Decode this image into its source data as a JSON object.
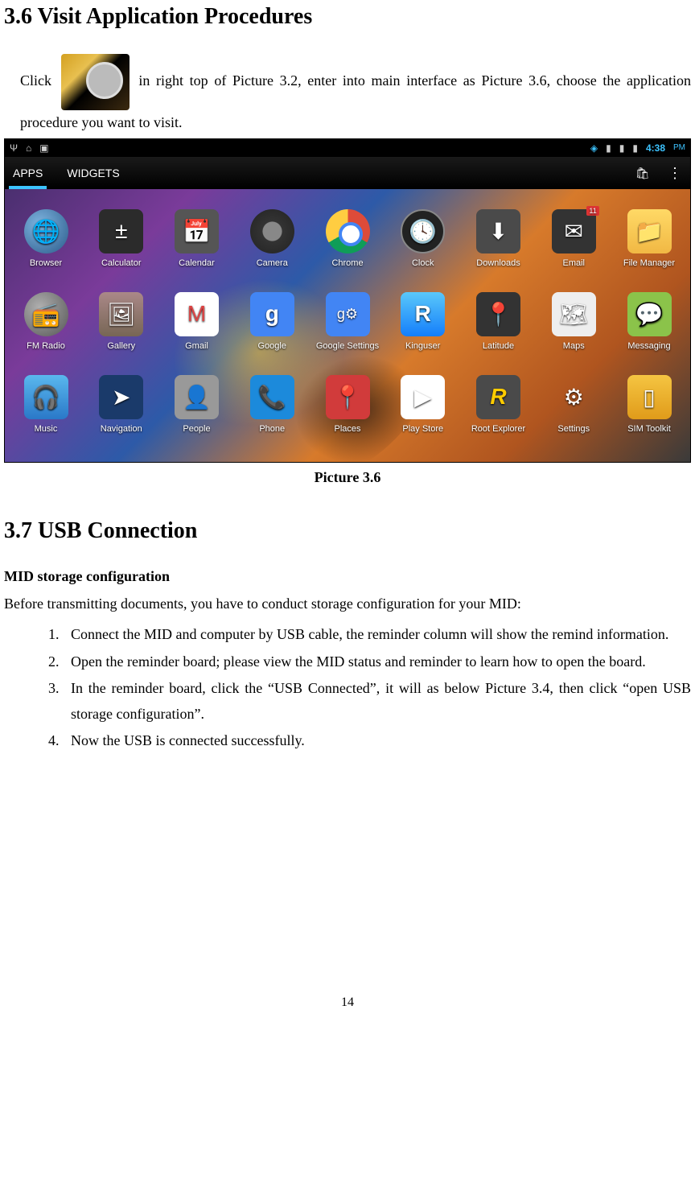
{
  "section36": {
    "title": "3.6 Visit Application Procedures",
    "para_before": "Click",
    "para_after": "in right top of Picture 3.2, enter into main interface as Picture 3.6, choose the application procedure you want to visit."
  },
  "screenshot": {
    "statusbar": {
      "left_icons": [
        "psi",
        "home",
        "android"
      ],
      "right_icons": [
        "wifi",
        "signal1",
        "signal2",
        "battery"
      ],
      "time": "4:38",
      "ampm": "PM"
    },
    "tabs": {
      "apps": "APPS",
      "widgets": "WIDGETS"
    },
    "apps": [
      [
        {
          "name": "Browser",
          "icon": "browser",
          "glyph": "🌐"
        },
        {
          "name": "Calculator",
          "icon": "calc",
          "glyph": "±"
        },
        {
          "name": "Calendar",
          "icon": "calendar",
          "glyph": "📅"
        },
        {
          "name": "Camera",
          "icon": "camera",
          "glyph": ""
        },
        {
          "name": "Chrome",
          "icon": "chrome",
          "glyph": ""
        },
        {
          "name": "Clock",
          "icon": "clock",
          "glyph": "🕓"
        },
        {
          "name": "Downloads",
          "icon": "downloads",
          "glyph": "⬇"
        },
        {
          "name": "Email",
          "icon": "email",
          "glyph": "✉",
          "badge": "11"
        },
        {
          "name": "File Manager",
          "icon": "filemgr",
          "glyph": "📁"
        }
      ],
      [
        {
          "name": "FM Radio",
          "icon": "fmradio",
          "glyph": "📻"
        },
        {
          "name": "Gallery",
          "icon": "gallery",
          "glyph": "🖼"
        },
        {
          "name": "Gmail",
          "icon": "gmail",
          "glyph": "M"
        },
        {
          "name": "Google",
          "icon": "google",
          "glyph": "g"
        },
        {
          "name": "Google Settings",
          "icon": "gsettings",
          "glyph": "g⚙"
        },
        {
          "name": "Kinguser",
          "icon": "kinguser",
          "glyph": "R"
        },
        {
          "name": "Latitude",
          "icon": "latitude",
          "glyph": "📍"
        },
        {
          "name": "Maps",
          "icon": "maps",
          "glyph": "🗺"
        },
        {
          "name": "Messaging",
          "icon": "messaging",
          "glyph": "💬"
        }
      ],
      [
        {
          "name": "Music",
          "icon": "music",
          "glyph": "🎧"
        },
        {
          "name": "Navigation",
          "icon": "navigation",
          "glyph": "➤"
        },
        {
          "name": "People",
          "icon": "people",
          "glyph": "👤"
        },
        {
          "name": "Phone",
          "icon": "phone",
          "glyph": "📞"
        },
        {
          "name": "Places",
          "icon": "places",
          "glyph": "📍"
        },
        {
          "name": "Play Store",
          "icon": "playstore",
          "glyph": "▶"
        },
        {
          "name": "Root Explorer",
          "icon": "rootexp",
          "glyph": "R"
        },
        {
          "name": "Settings",
          "icon": "settings",
          "glyph": "⚙"
        },
        {
          "name": "SIM Toolkit",
          "icon": "simtk",
          "glyph": "▯"
        }
      ]
    ],
    "caption": "Picture 3.6"
  },
  "section37": {
    "title": "3.7 USB Connection",
    "subheading": "MID storage configuration",
    "intro": "Before transmitting documents, you have to conduct storage configuration for your MID:",
    "steps": [
      {
        "n": "1.",
        "t": "Connect the MID and computer by USB cable, the reminder column will show the remind information."
      },
      {
        "n": "2.",
        "t": "Open the reminder board; please view the MID status and reminder to learn how to open the board."
      },
      {
        "n": "3.",
        "t": "In the reminder board, click the “USB Connected”, it will as below Picture 3.4, then click “open USB storage configuration”."
      },
      {
        "n": "4.",
        "t": "Now the USB is connected successfully."
      }
    ]
  },
  "page_number": "14"
}
